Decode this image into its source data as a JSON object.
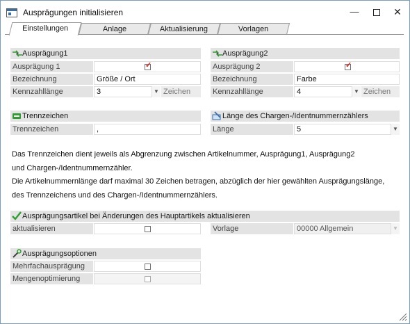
{
  "window": {
    "title": "Ausprägungen initialisieren",
    "min_glyph": "—",
    "close_glyph": "✕"
  },
  "tabs": [
    {
      "label": "Einstellungen",
      "active": true
    },
    {
      "label": "Anlage",
      "active": false
    },
    {
      "label": "Aktualisierung",
      "active": false
    },
    {
      "label": "Vorlagen",
      "active": false
    }
  ],
  "auspraegung1": {
    "header": "Ausprägung1",
    "icon": "link-arrows-icon",
    "rows": {
      "active_label": "Ausprägung 1",
      "active_checked": true,
      "name_label": "Bezeichnung",
      "name_value": "Größe / Ort",
      "length_label": "Kennzahllänge",
      "length_value": "3",
      "length_unit": "Zeichen"
    }
  },
  "auspraegung2": {
    "header": "Ausprägung2",
    "icon": "link-arrows-icon",
    "rows": {
      "active_label": "Ausprägung 2",
      "active_checked": true,
      "name_label": "Bezeichnung",
      "name_value": "Farbe",
      "length_label": "Kennzahllänge",
      "length_value": "4",
      "length_unit": "Zeichen"
    }
  },
  "trennzeichen": {
    "header": "Trennzeichen",
    "icon": "separator-icon",
    "label": "Trennzeichen",
    "value": ","
  },
  "zaehler": {
    "header": "Länge des Chargen-/Identnummernzählers",
    "icon": "counter-icon",
    "label": "Länge",
    "value": "5"
  },
  "info_text": [
    "Das Trennzeichen dient jeweils als Abgrenzung zwischen Artikelnummer, Ausprägung1, Ausprägung2",
    "und Chargen-/Identnummernzähler.",
    "Die Artikelnummernlänge darf maximal 30 Zeichen betragen, abzüglich der hier gewählten Ausprägungslänge,",
    "des Trennzeichens und des Chargen-/Identnummernzählers."
  ],
  "update": {
    "header": "Ausprägungsartikel bei Änderungen des Hauptartikels aktualisieren",
    "icon": "checkmark-icon",
    "label": "aktualisieren",
    "checked": false,
    "template_label": "Vorlage",
    "template_value": "00000 Allgemein"
  },
  "options": {
    "header": "Ausprägungsoptionen",
    "icon": "tools-icon",
    "multi_label": "Mehrfachausprägung",
    "multi_checked": false,
    "quantity_label": "Mengenoptimierung",
    "quantity_checked": false
  },
  "colors": {
    "section_bg": "#e3e3e3",
    "check_red": "#dd2222",
    "icon_green": "#2e9e2e"
  }
}
